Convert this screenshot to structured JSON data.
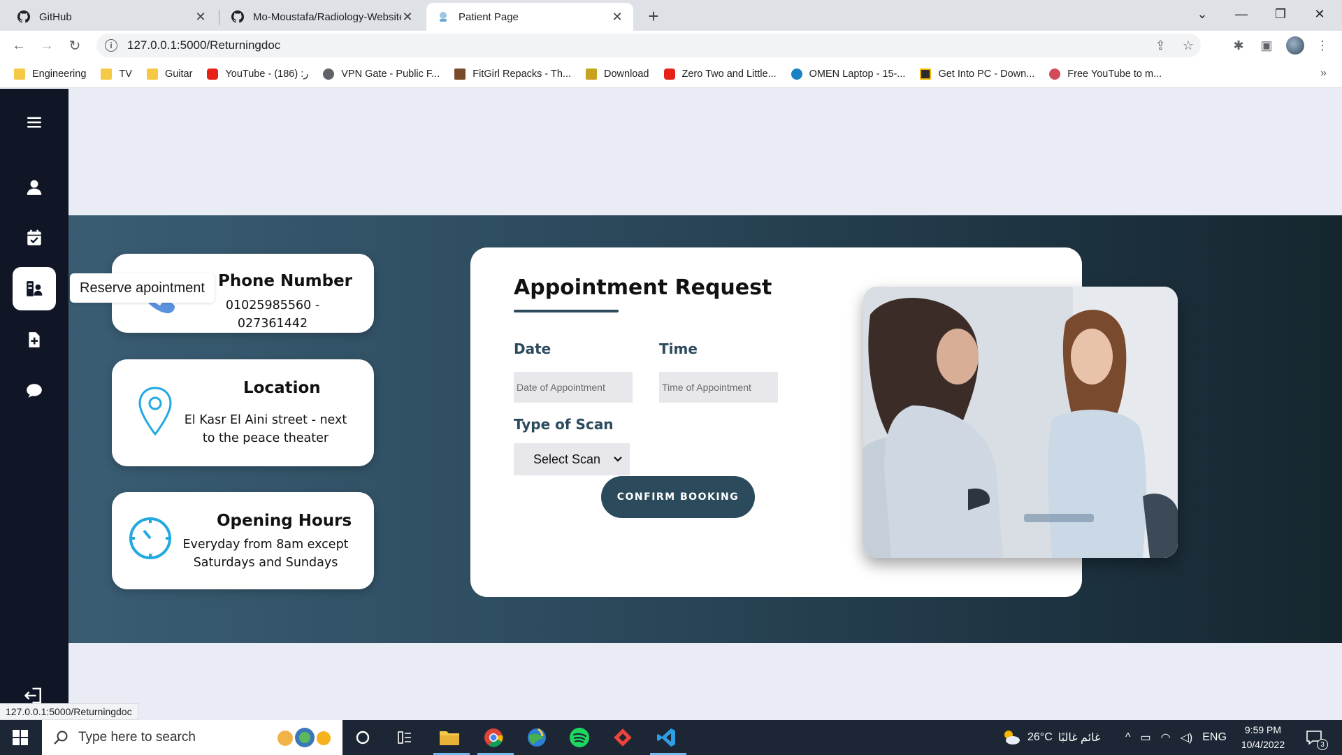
{
  "browser": {
    "tabs": [
      {
        "title": "GitHub",
        "active": false
      },
      {
        "title": "Mo-Moustafa/Radiology-Website",
        "active": false
      },
      {
        "title": "Patient Page",
        "active": true
      }
    ],
    "url": "127.0.0.1:5000/Returningdoc",
    "bookmarks": [
      {
        "label": "Engineering",
        "icon": "folder-icon"
      },
      {
        "label": "TV",
        "icon": "folder-icon"
      },
      {
        "label": "Guitar",
        "icon": "folder-icon"
      },
      {
        "label": "YouTube - ر: (186)",
        "icon": "youtube-icon"
      },
      {
        "label": "VPN Gate - Public F...",
        "icon": "globe-icon"
      },
      {
        "label": "FitGirl Repacks - Th...",
        "icon": "fitgirl-icon"
      },
      {
        "label": "Download",
        "icon": "download-icon"
      },
      {
        "label": "Zero Two and Little...",
        "icon": "youtube-icon"
      },
      {
        "label": "OMEN Laptop - 15-...",
        "icon": "hp-icon"
      },
      {
        "label": "Get Into PC - Down...",
        "icon": "getintopc-icon"
      },
      {
        "label": "Free YouTube to m...",
        "icon": "freeyoutube-icon"
      }
    ],
    "status_url": "127.0.0.1:5000/Returningdoc"
  },
  "sidebar": {
    "tooltip": "Reserve apointment",
    "items": [
      "menu-icon",
      "user-icon",
      "calendar-check-icon",
      "reserve-appointment-icon",
      "medical-file-icon",
      "chat-icon"
    ]
  },
  "contact": {
    "phone": {
      "title": "Phone Number",
      "text": "01025985560 - 027361442"
    },
    "location": {
      "title": "Location",
      "text": "El Kasr El Aini street - next to the peace theater"
    },
    "hours": {
      "title": "Opening Hours",
      "text": "Everyday from 8am except Saturdays and Sundays"
    }
  },
  "form": {
    "title": "Appointment Request",
    "date_label": "Date",
    "date_placeholder": "Date of Appointment",
    "time_label": "Time",
    "time_placeholder": "Time of Appointment",
    "scan_label": "Type of Scan",
    "scan_selected": "Select Scan",
    "confirm_label": "CONFIRM BOOKING"
  },
  "taskbar": {
    "search_placeholder": "Type here to search",
    "weather": "26°C",
    "weather_desc": "غائم غالبًا",
    "language": "ENG",
    "time": "9:59 PM",
    "date": "10/4/2022",
    "notifications": "3"
  },
  "colors": {
    "sidebar": "#101626",
    "primary": "#2b4a5c",
    "accent_icon": "#22a9e0"
  }
}
